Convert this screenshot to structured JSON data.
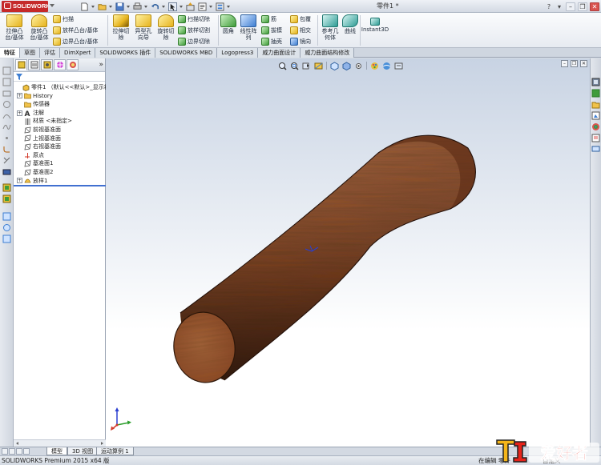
{
  "titlebar": {
    "app": "SOLIDWORKS",
    "document": "零件1 *",
    "icons": [
      "new-document-icon",
      "open-icon",
      "save-icon",
      "print-icon",
      "undo-icon",
      "select-icon",
      "rebuild-icon",
      "file-properties-icon",
      "options-icon"
    ],
    "right_icons": [
      "help-icon",
      "search-icon"
    ]
  },
  "ribbon": {
    "extrude_boss": "拉伸凸\n台/基体",
    "revolve_boss": "旋转凸\n台/基体",
    "sweep": "扫描",
    "loft_boss": "放样凸台/基体",
    "boundary_boss": "边界凸台/基体",
    "extrude_cut": "拉伸切\n除",
    "hole_wizard": "异型孔\n向导",
    "revolve_cut": "旋转切\n除",
    "swept_cut": "扫描切除",
    "lofted_cut": "放样切割",
    "boundary_cut": "边界切除",
    "fillet": "圆角",
    "linear_pattern": "线性阵\n列",
    "rib": "筋",
    "draft": "拔模",
    "shell": "抽壳",
    "wrap": "包覆",
    "intersect": "相交",
    "mirror": "镜向",
    "reference_geometry": "参考几\n何体",
    "curves": "曲线",
    "instant3d": "Instant3D"
  },
  "command_tabs": [
    "特征",
    "草图",
    "评估",
    "DimXpert",
    "SOLIDWORKS 插件",
    "SOLIDWORKS MBD",
    "Logopress3",
    "威力曲面设计",
    "威力曲面结构修改"
  ],
  "feature_tree": {
    "header_expand": "»",
    "items": [
      {
        "label": "零件1 （默认<<默认>_显示状态",
        "icon": "part-icon",
        "expander": ""
      },
      {
        "label": "History",
        "icon": "history-folder-icon",
        "expander": "+"
      },
      {
        "label": "传感器",
        "icon": "sensors-folder-icon",
        "expander": ""
      },
      {
        "label": "注解",
        "icon": "annotations-icon",
        "expander": "+"
      },
      {
        "label": "材质 <未指定>",
        "icon": "material-icon",
        "expander": ""
      },
      {
        "label": "前视基准面",
        "icon": "plane-icon",
        "expander": ""
      },
      {
        "label": "上视基准面",
        "icon": "plane-icon",
        "expander": ""
      },
      {
        "label": "右视基准面",
        "icon": "plane-icon",
        "expander": ""
      },
      {
        "label": "原点",
        "icon": "origin-icon",
        "expander": ""
      },
      {
        "label": "基准面1",
        "icon": "plane-icon",
        "expander": ""
      },
      {
        "label": "基准面2",
        "icon": "plane-icon",
        "expander": ""
      },
      {
        "label": "放样1",
        "icon": "loft-feature-icon",
        "expander": "+"
      }
    ]
  },
  "model": {
    "feature": "放样1",
    "material_look": "wood",
    "colors": {
      "end_face": "#a8653a",
      "body_dark": "#5a2814",
      "body_mid": "#8e4a26",
      "body_light": "#b56f42"
    }
  },
  "bottom_tabs": [
    "模型",
    "3D 视图",
    "运动算例 1"
  ],
  "status": {
    "product": "SOLIDWORKS Premium 2015 x64 版",
    "mode": "在编辑 零件",
    "units": "自定义"
  },
  "watermark": {
    "text": "爱好者",
    "logo_char": "木工"
  }
}
